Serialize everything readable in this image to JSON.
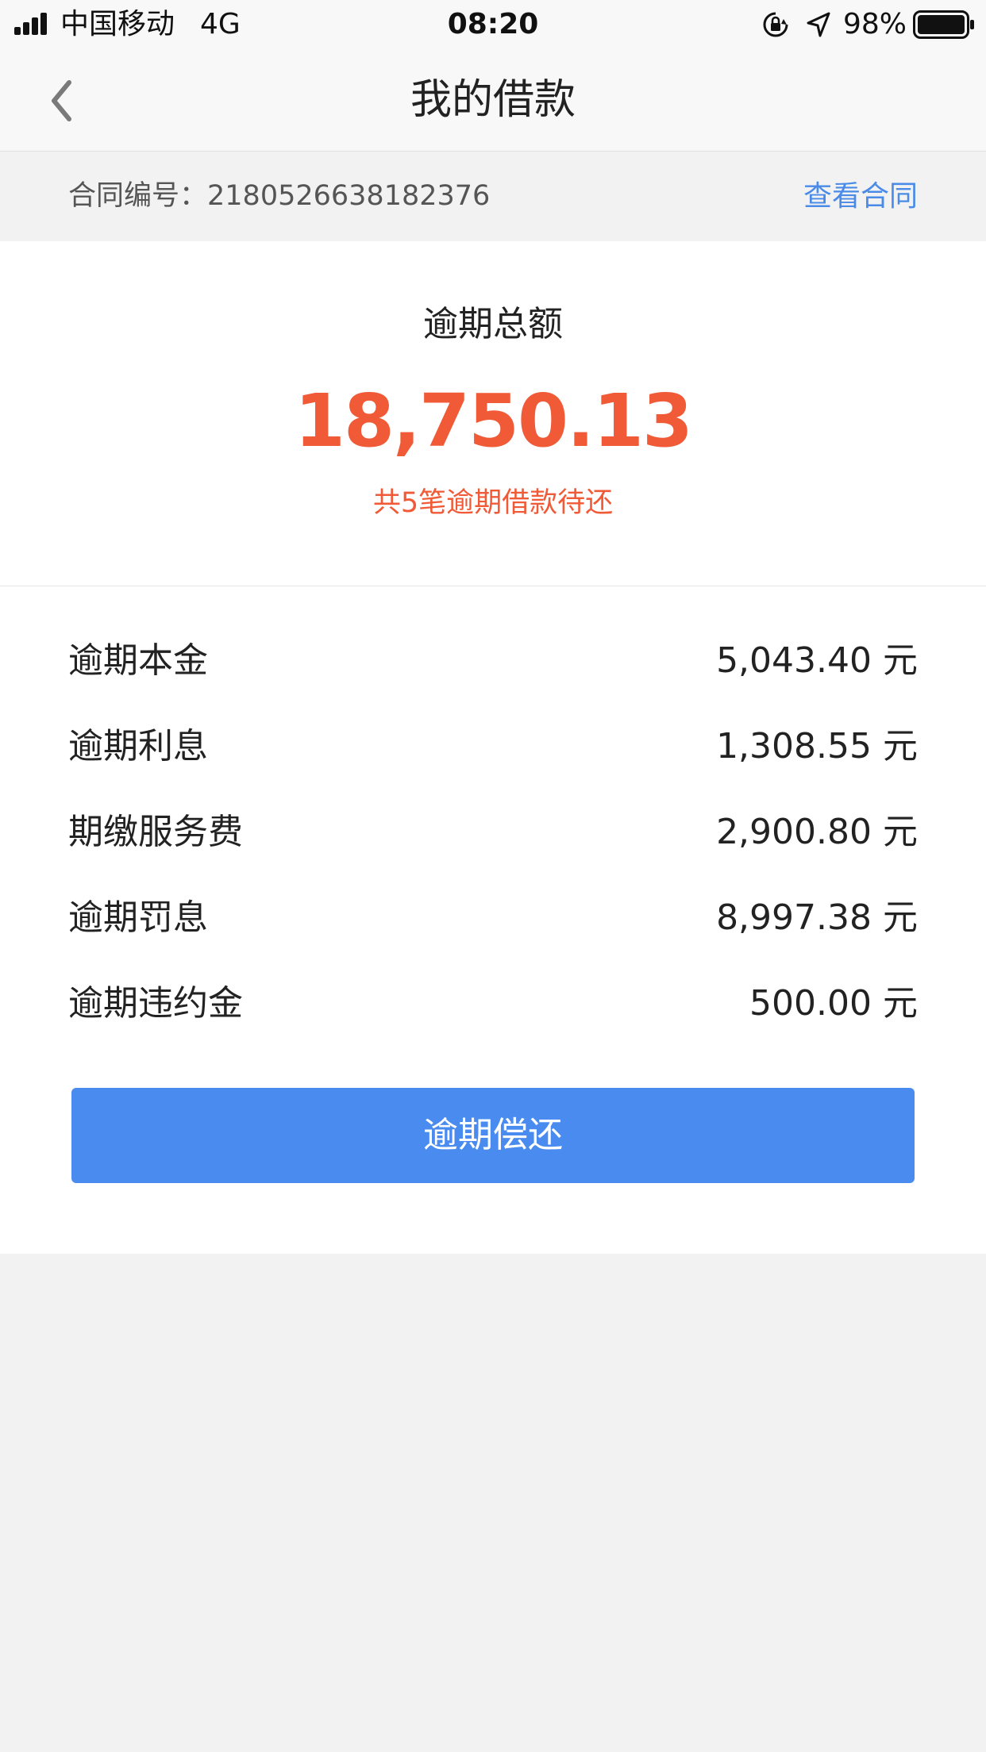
{
  "status_bar": {
    "carrier": "中国移动",
    "network": "4G",
    "time": "08:20",
    "battery_percent": "98%",
    "icons": [
      "signal-icon",
      "lock-rotation-icon",
      "location-icon",
      "battery-icon"
    ]
  },
  "nav": {
    "title": "我的借款",
    "back_icon": "chevron-left-icon"
  },
  "contract": {
    "label": "合同编号：",
    "number": "2180526638182376",
    "view_link": "查看合同"
  },
  "summary": {
    "label": "逾期总额",
    "amount": "18,750.13",
    "note": "共5笔逾期借款待还"
  },
  "details": [
    {
      "label": "逾期本金",
      "value": "5,043.40 元"
    },
    {
      "label": "逾期利息",
      "value": "1,308.55 元"
    },
    {
      "label": "期缴服务费",
      "value": "2,900.80 元"
    },
    {
      "label": "逾期罚息",
      "value": "8,997.38 元"
    },
    {
      "label": "逾期违约金",
      "value": "500.00 元"
    }
  ],
  "actions": {
    "repay_label": "逾期偿还"
  },
  "colors": {
    "accent_red": "#f05a37",
    "link_blue": "#4a8be8",
    "button_blue": "#4a8bef",
    "background": "#f2f2f2"
  }
}
